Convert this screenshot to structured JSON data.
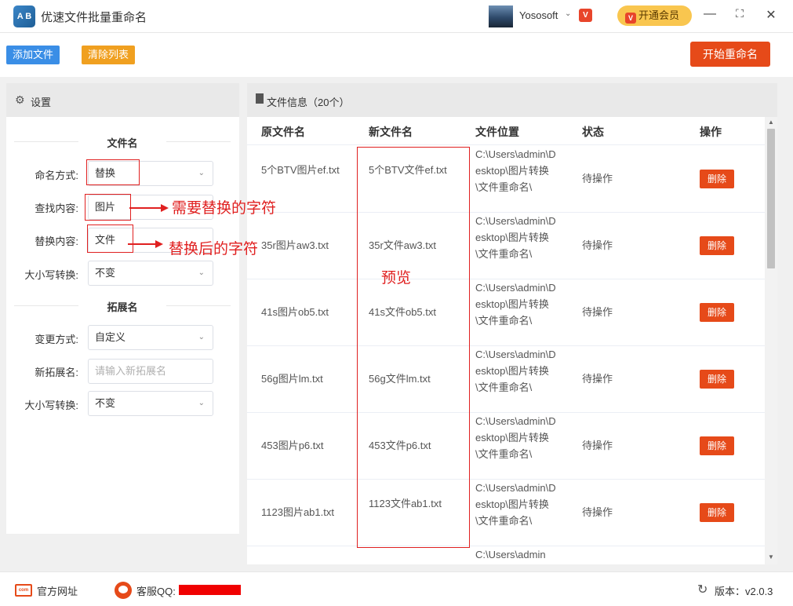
{
  "app": {
    "title": "优速文件批量重命名",
    "logo_text": "A B"
  },
  "user": {
    "name": "Yososoft",
    "vip_button": "开通会员"
  },
  "toolbar": {
    "add_files": "添加文件",
    "clear_list": "清除列表",
    "start_rename": "开始重命名"
  },
  "settings": {
    "header": "设置",
    "filename_section": "文件名",
    "naming_mode_label": "命名方式:",
    "naming_mode_value": "替换",
    "find_label": "查找内容:",
    "find_value": "图片",
    "replace_label": "替换内容:",
    "replace_value": "文件",
    "case_label": "大小写转换:",
    "case_value": "不变",
    "ext_section": "拓展名",
    "ext_mode_label": "变更方式:",
    "ext_mode_value": "自定义",
    "new_ext_label": "新拓展名:",
    "new_ext_placeholder": "请输入新拓展名",
    "ext_case_label": "大小写转换:",
    "ext_case_value": "不变"
  },
  "annotations": {
    "find_note": "需要替换的字符",
    "replace_note": "替换后的字符",
    "preview_note": "预览"
  },
  "files": {
    "header": "文件信息（20个）",
    "columns": [
      "原文件名",
      "新文件名",
      "文件位置",
      "状态",
      "操作"
    ],
    "rows": [
      {
        "original": "5个BTV图片ef.txt",
        "new": "5个BTV文件ef.txt",
        "location": "C:\\Users\\admin\\Desktop\\图片转换\\文件重命名\\",
        "status": "待操作",
        "action": "删除"
      },
      {
        "original": "35r图片aw3.txt",
        "new": "35r文件aw3.txt",
        "location": "C:\\Users\\admin\\Desktop\\图片转换\\文件重命名\\",
        "status": "待操作",
        "action": "删除"
      },
      {
        "original": "41s图片ob5.txt",
        "new": "41s文件ob5.txt",
        "location": "C:\\Users\\admin\\Desktop\\图片转换\\文件重命名\\",
        "status": "待操作",
        "action": "删除"
      },
      {
        "original": "56g图片lm.txt",
        "new": "56g文件lm.txt",
        "location": "C:\\Users\\admin\\Desktop\\图片转换\\文件重命名\\",
        "status": "待操作",
        "action": "删除"
      },
      {
        "original": "453图片p6.txt",
        "new": "453文件p6.txt",
        "location": "C:\\Users\\admin\\Desktop\\图片转换\\文件重命名\\",
        "status": "待操作",
        "action": "删除"
      },
      {
        "original": "1123图片ab1.txt",
        "new": "1123文件ab1.txt",
        "location": "C:\\Users\\admin\\Desktop\\图片转换\\文件重命名\\",
        "status": "待操作",
        "action": "删除"
      },
      {
        "original": "",
        "new": "",
        "location": "C:\\Users\\admin",
        "status": "",
        "action": ""
      }
    ]
  },
  "footer": {
    "site": "官方网址",
    "qq": "客服QQ:",
    "version": "版本：v2.0.3"
  },
  "colors": {
    "primary_blue": "#3a8ee6",
    "warning_orange": "#f0a020",
    "danger_red": "#e64a19",
    "annotation_red": "#e02020",
    "vip_yellow": "#f9c64f"
  }
}
